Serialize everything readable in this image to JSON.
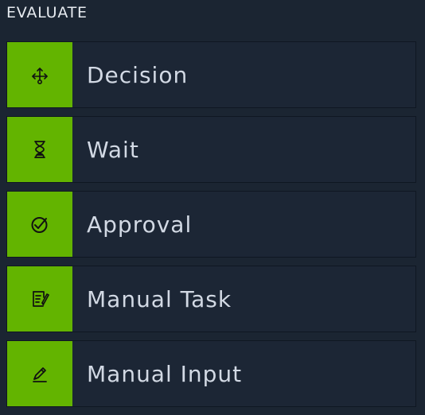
{
  "section": {
    "title": "EVALUATE"
  },
  "items": [
    {
      "label": "Decision",
      "icon": "decision-icon"
    },
    {
      "label": "Wait",
      "icon": "hourglass-icon"
    },
    {
      "label": "Approval",
      "icon": "check-circle-icon"
    },
    {
      "label": "Manual Task",
      "icon": "manual-task-icon"
    },
    {
      "label": "Manual Input",
      "icon": "pencil-icon"
    }
  ],
  "colors": {
    "background": "#1b2532",
    "card": "#1c2635",
    "accent": "#63b400",
    "text": "#d2d9e4"
  }
}
